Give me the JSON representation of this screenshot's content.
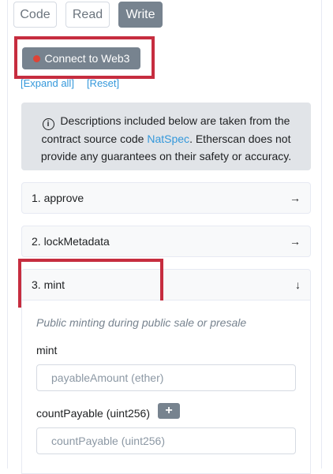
{
  "tabs": [
    {
      "label": "Code",
      "active": false
    },
    {
      "label": "Read",
      "active": false
    },
    {
      "label": "Write",
      "active": true
    }
  ],
  "connect_button": {
    "label": "Connect to Web3",
    "status_color": "#de4437"
  },
  "links": {
    "expand_all": "[Expand all]",
    "reset": "[Reset]"
  },
  "notice": {
    "prefix": " Descriptions included below are taken from the contract source code ",
    "link": "NatSpec",
    "suffix": ". Etherscan does not provide any guarantees on their safety or accuracy."
  },
  "functions": [
    {
      "label": "1. approve",
      "arrow": "→"
    },
    {
      "label": "2. lockMetadata",
      "arrow": "→"
    },
    {
      "label": "3. mint",
      "arrow": "↓"
    }
  ],
  "mint": {
    "description": "Public minting during public sale or presale",
    "payable_label": "mint",
    "payable_placeholder": "payableAmount (ether)",
    "count_label": "countPayable (uint256)",
    "plus_label": "+",
    "count_placeholder": "countPayable (uint256)"
  },
  "colors": {
    "highlight": "#c62d3f",
    "link": "#3498db",
    "button": "#77838f"
  }
}
